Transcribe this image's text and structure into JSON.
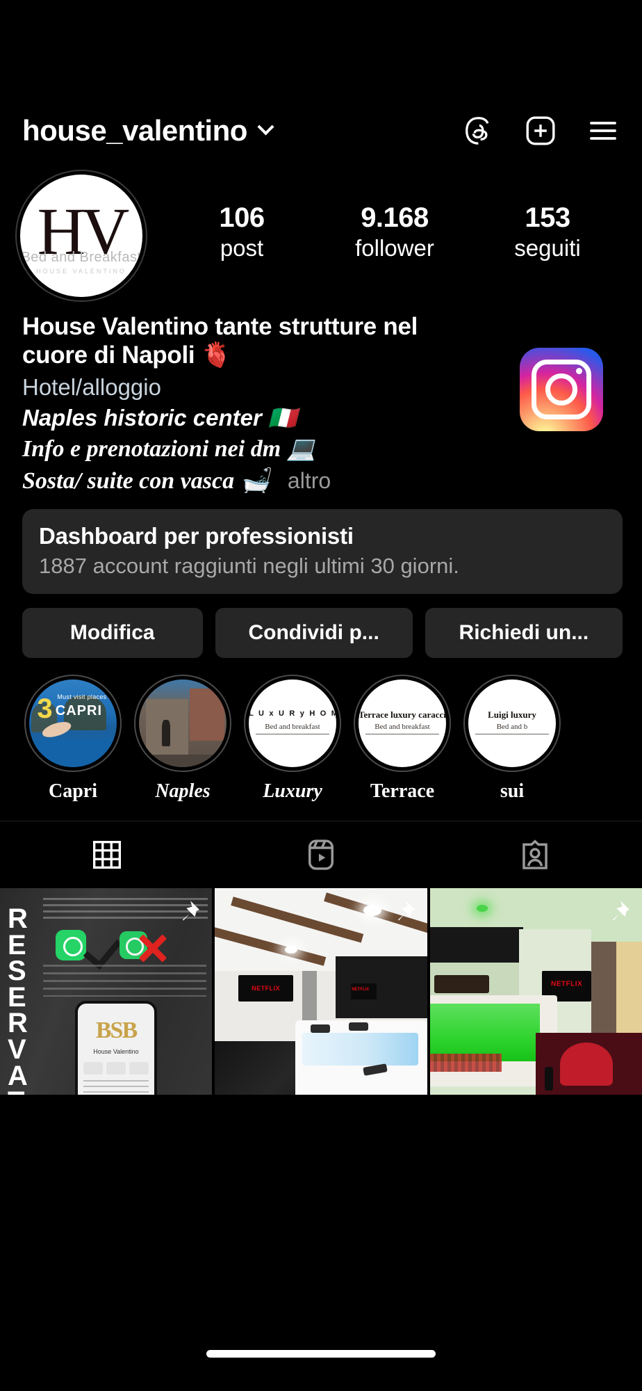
{
  "header": {
    "username": "house_valentino",
    "chevron_icon": "chevron-down-icon",
    "threads_icon": "threads-icon",
    "add_icon": "plus-square-icon",
    "menu_icon": "hamburger-menu-icon"
  },
  "profile": {
    "avatar": {
      "monogram": "HV",
      "sub": "Bed and Breakfast",
      "sub2": "HOUSE VALENTINO"
    },
    "stats": [
      {
        "num": "106",
        "label": "post"
      },
      {
        "num": "9.168",
        "label": "follower"
      },
      {
        "num": "153",
        "label": "seguiti"
      }
    ]
  },
  "bio": {
    "title": "House Valentino tante strutture nel cuore di Napoli 🫀",
    "category": "Hotel/alloggio",
    "line1": "Naples historic center 🇮🇹",
    "line2": "Info e prenotazioni nei dm 💻",
    "line3": "Sosta/ suite con vasca 🛁",
    "more": "altro",
    "badge_icon": "instagram-logo-icon"
  },
  "dashboard": {
    "title": "Dashboard per professionisti",
    "subtitle": "1887 account raggiunti negli ultimi 30 giorni."
  },
  "actions": [
    {
      "label": "Modifica"
    },
    {
      "label": "Condividi p..."
    },
    {
      "label": "Richiedi un..."
    }
  ],
  "highlights": [
    {
      "label": "Capri",
      "cover_kind": "photo-capri",
      "cover_text_1": "3",
      "cover_text_2": "CAPRI",
      "cover_text_3": "Must visit places in"
    },
    {
      "label": "Naples",
      "cover_kind": "photo-naples",
      "cover_text_1": "",
      "cover_text_2": "",
      "cover_text_3": ""
    },
    {
      "label": "Luxury",
      "cover_kind": "logo",
      "cover_text_1": "L U x U R y   H O M E",
      "cover_text_2": "Bed and breakfast",
      "cover_text_3": ""
    },
    {
      "label": "Terrace",
      "cover_kind": "logo",
      "cover_text_1": "Terrace luxury caracciolo",
      "cover_text_2": "Bed and breakfast",
      "cover_text_3": ""
    },
    {
      "label": "sui",
      "cover_kind": "logo",
      "cover_text_1": "Luigi luxury",
      "cover_text_2": "Bed and b",
      "cover_text_3": ""
    }
  ],
  "tabs": [
    {
      "name": "grid",
      "icon": "grid-icon",
      "active": true
    },
    {
      "name": "reels",
      "icon": "reels-icon",
      "active": false
    },
    {
      "name": "tagged",
      "icon": "tagged-icon",
      "active": false
    }
  ],
  "grid_posts": [
    {
      "kind": "reservation-flyer",
      "vertical_text": "RESERVATIO",
      "logo_text": "BSB",
      "account_name": "House Valentino",
      "pinned": true,
      "pin_icon": "pin-icon"
    },
    {
      "kind": "white-jacuzzi-room",
      "tv_text": "NETFLIX",
      "pinned": true,
      "pin_icon": "pin-icon"
    },
    {
      "kind": "green-jacuzzi-room",
      "tv_text": "NETFLIX",
      "pinned": true,
      "pin_icon": "pin-icon"
    }
  ],
  "colors": {
    "background": "#000000",
    "surface": "#262626",
    "text_primary": "#ffffff",
    "text_secondary": "#a8a8a8",
    "category_text": "#c8d4de",
    "netflix_red": "#e50914",
    "whatsapp_green": "#25d366"
  }
}
